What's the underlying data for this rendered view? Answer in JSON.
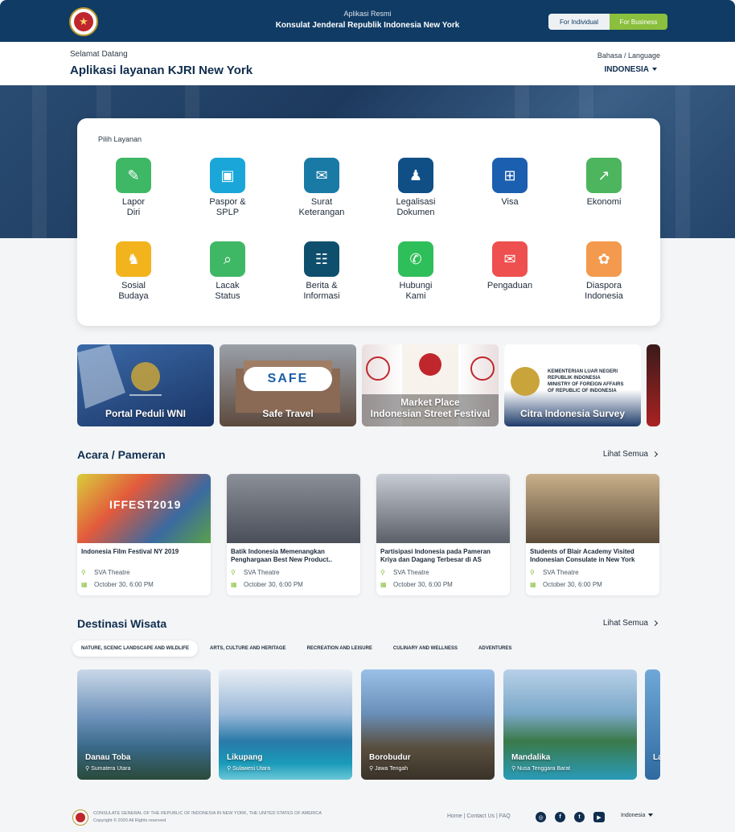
{
  "header": {
    "subtitle": "Aplikasi Resmi",
    "title": "Konsulat Jenderal Republik Indonesia New York",
    "toggle": {
      "individual": "For Individual",
      "business": "For Business"
    }
  },
  "greeting": {
    "welcome": "Selamat Datang",
    "app_title": "Aplikasi layanan KJRI New York",
    "language_label": "Bahasa / Language",
    "language_value": "INDONESIA"
  },
  "services": {
    "heading": "Pilih Layanan",
    "items": [
      {
        "label": "Lapor\nDiri",
        "icon": "report-self-icon",
        "color": "#3fb866"
      },
      {
        "label": "Paspor &\nSPLP",
        "icon": "passport-icon",
        "color": "#1aa6d8"
      },
      {
        "label": "Surat\nKeterangan",
        "icon": "document-icon",
        "color": "#1a7aa6"
      },
      {
        "label": "Legalisasi\nDokumen",
        "icon": "stamp-icon",
        "color": "#0f4f86"
      },
      {
        "label": "Visa",
        "icon": "visa-icon",
        "color": "#1b5fb0"
      },
      {
        "label": "Ekonomi",
        "icon": "chart-icon",
        "color": "#4cb55d"
      },
      {
        "label": "Sosial\nBudaya",
        "icon": "culture-icon",
        "color": "#f2b31c"
      },
      {
        "label": "Lacak\nStatus",
        "icon": "track-icon",
        "color": "#3fb866"
      },
      {
        "label": "Berita  &\nInformasi",
        "icon": "news-icon",
        "color": "#0f4f6e"
      },
      {
        "label": "Hubungi\nKami",
        "icon": "phone-icon",
        "color": "#2fbf5a"
      },
      {
        "label": "Pengaduan",
        "icon": "complaint-icon",
        "color": "#ee4f4f"
      },
      {
        "label": "Diaspora\nIndonesia",
        "icon": "diaspora-icon",
        "color": "#f39a4e"
      }
    ]
  },
  "banners": [
    {
      "label": "Portal Peduli WNI",
      "bg": "#1e3f72"
    },
    {
      "label": "Safe Travel",
      "bg": "#6b5a4f",
      "logo_text": "SAFE"
    },
    {
      "label": "Market Place\nIndonesian Street Festival",
      "bg": "#b33a3a"
    },
    {
      "label": "Citra Indonesia Survey",
      "bg": "#2a4a7a",
      "inset": "KEMENTERIAN LUAR NEGERI\nREPUBLIK INDONESIA\nMINISTRY OF FOREIGN AFFAIRS\nOF REPUBLIC OF INDONESIA"
    }
  ],
  "events": {
    "title": "Acara / Pameran",
    "see_all": "Lihat Semua",
    "items": [
      {
        "title": "Indonesia Film Festival NY 2019",
        "venue": "SVA Theatre",
        "date": "October 30, 6:00 PM",
        "poster": "IFFEST2019"
      },
      {
        "title": "Batik Indonesia Memenangkan Penghargaan Best New Product..",
        "venue": "SVA Theatre",
        "date": "October 30, 6:00 PM"
      },
      {
        "title": "Partisipasi Indonesia pada Pameran Kriya dan Dagang Terbesar di AS",
        "venue": "SVA Theatre",
        "date": "October 30, 6:00 PM"
      },
      {
        "title": "Students of Blair Academy Visited Indonesian Consulate in New York",
        "venue": "SVA Theatre",
        "date": "October 30, 6:00 PM"
      }
    ]
  },
  "destinations": {
    "title": "Destinasi Wisata",
    "see_all": "Lihat Semua",
    "tabs": [
      "NATURE, SCENIC LANDSCAPE AND WILDLIFE",
      "ARTS, CULTURE AND HERITAGE",
      "RECREATION AND LEISURE",
      "CULINARY AND WELLNESS",
      "ADVENTURES"
    ],
    "items": [
      {
        "name": "Danau Toba",
        "location": "Sumatera Utara"
      },
      {
        "name": "Likupang",
        "location": "Sulawesi Utara"
      },
      {
        "name": "Borobudur",
        "location": "Jawa Tengah"
      },
      {
        "name": "Mandalika",
        "location": "Nusa Tenggara Barat"
      }
    ],
    "partial": "La"
  },
  "footer": {
    "line1": "CONSULATE GENERAL OF THE REPUBLIC OF INDONESIA IN NEW YORK, THE UNITED STATES OF AMERICA",
    "line2": "Copyright © 2020 All Rights reserved",
    "links": "Home | Contact Us  | FAQ",
    "language": "Indonesia"
  }
}
